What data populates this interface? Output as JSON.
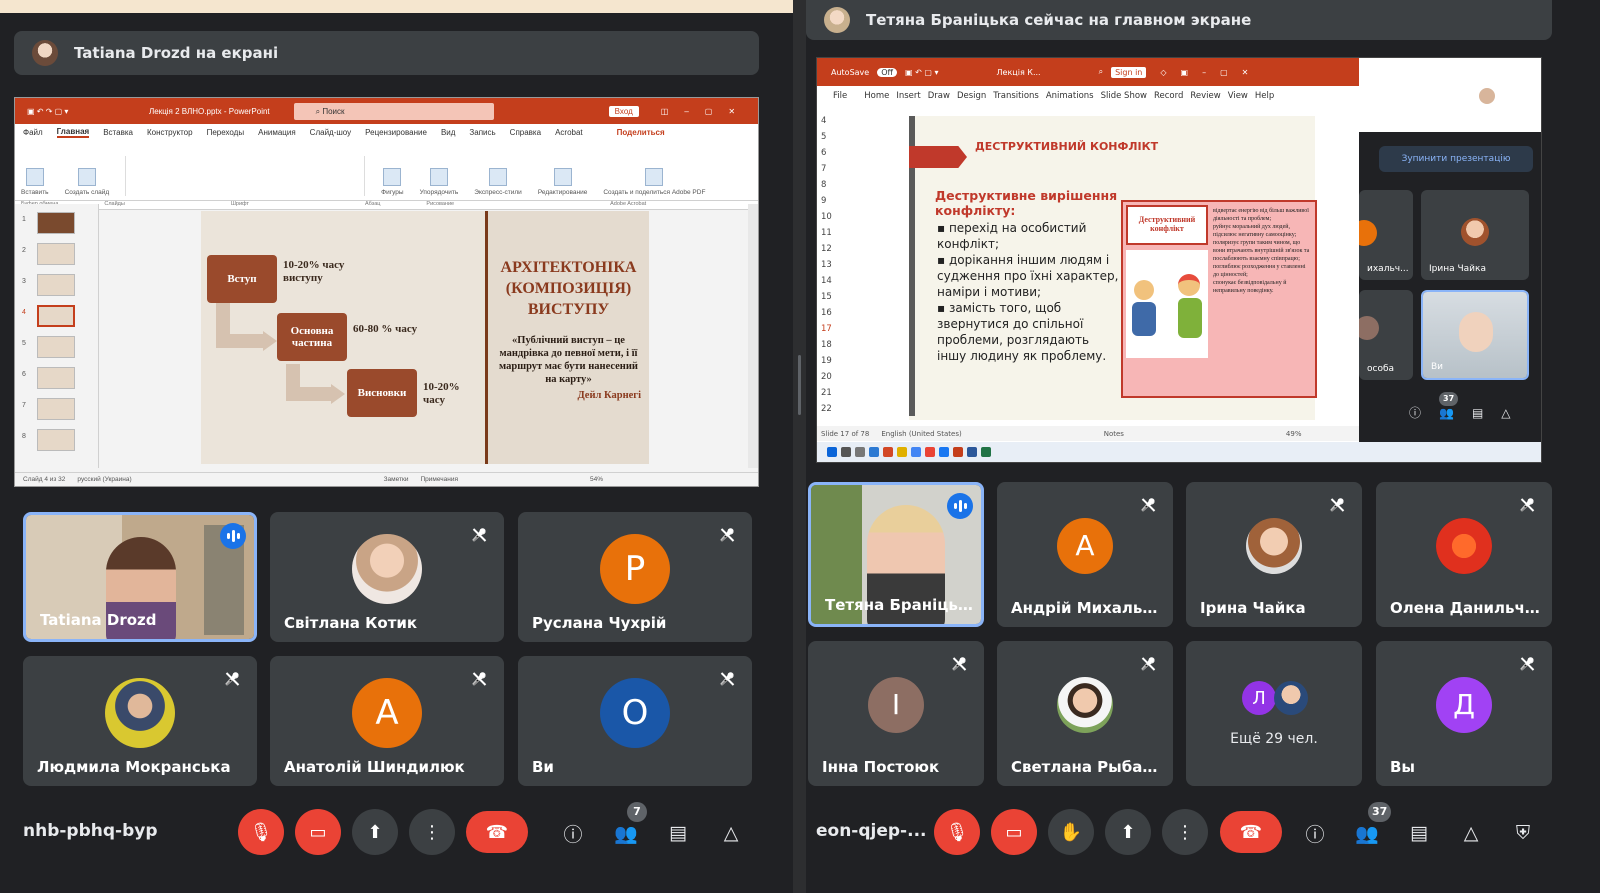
{
  "left": {
    "banner": "Tatiana Drozd на екрані",
    "ppt": {
      "title": "Лекція 2 ВЛНО.pptx  -  PowerPoint",
      "search": "Поиск",
      "signin": "Вход",
      "menu": [
        "Файл",
        "Главная",
        "Вставка",
        "Конструктор",
        "Переходы",
        "Анимация",
        "Слайд-шоу",
        "Рецензирование",
        "Вид",
        "Запись",
        "Справка",
        "Acrobat"
      ],
      "share": "Поделиться",
      "ribbon": [
        "Вставить",
        "Создать слайд",
        "Фигуры",
        "Упорядочить",
        "Экспресс-стили",
        "Редактирование",
        "Создать и поделиться Adobe PDF"
      ],
      "ribbon_groups": [
        "Буфер обмена",
        "Слайды",
        "Шрифт",
        "Абзац",
        "Рисование",
        "Adobe Acrobat"
      ],
      "slide": {
        "box1": "Вступ",
        "box2": "Основна частина",
        "box3": "Висновки",
        "pct1": "10-20% часу виступу",
        "pct2": "60-80 % часу",
        "pct3": "10-20% часу",
        "heading": "АРХІТЕКТОНІКА (КОМПОЗИЦІЯ) ВИСТУПУ",
        "quote": "«Публічний виступ – це мандрівка до певної мети, і її маршрут має бути нанесений на карту»",
        "author": "Дейл Карнегі"
      },
      "thumb_numbers": [
        "1",
        "2",
        "3",
        "4",
        "5",
        "6",
        "7",
        "8"
      ],
      "status_left": "Слайд 4 из 32",
      "status_lang": "русский (Украина)",
      "status_notes": "Заметки",
      "status_comments": "Примечания",
      "zoom": "54%"
    },
    "tiles": [
      {
        "name": "Tatiana Drozd",
        "kind": "video",
        "speaking": true
      },
      {
        "name": "Світлана Котик",
        "kind": "photo",
        "muted": true
      },
      {
        "name": "Руслана Чухрій",
        "kind": "letter",
        "letter": "Р",
        "color": "#e8710a",
        "muted": true
      },
      {
        "name": "Людмила Мокранська",
        "kind": "photo",
        "muted": true
      },
      {
        "name": "Анатолій Шиндилюк",
        "kind": "letter",
        "letter": "А",
        "color": "#e8710a",
        "muted": true
      },
      {
        "name": "Ви",
        "kind": "letter",
        "letter": "О",
        "color": "#1a57a8",
        "muted": true
      }
    ],
    "meeting_code": "nhb-pbhq-byp",
    "participants_count": "7"
  },
  "right": {
    "banner": "Тетяна Браніцька сейчас на главном экране",
    "ppt": {
      "autosave": "AutoSave",
      "autosave_state": "Off",
      "file": "Лекція К...",
      "signin": "Sign in",
      "menu": [
        "File",
        "Home",
        "Insert",
        "Draw",
        "Design",
        "Transitions",
        "Animations",
        "Slide Show",
        "Record",
        "Review",
        "View",
        "Help"
      ],
      "line_numbers": [
        "4",
        "5",
        "6",
        "7",
        "8",
        "9",
        "10",
        "11",
        "12",
        "13",
        "14",
        "15",
        "16",
        "17",
        "18",
        "19",
        "20",
        "21",
        "22"
      ],
      "slide": {
        "title": "ДЕСТРУКТИВНИЙ КОНФЛІКТ",
        "subtitle": "Деструктивне вирішення конфлікту:",
        "bullets": [
          "перехід на особистий конфлікт;",
          "дорікання іншим людям і судження про їхні характер, наміри і мотиви;",
          "замість того, щоб звернутися до спільної проблеми, розглядають іншу людину як проблему."
        ],
        "card_title": "Деструктивний конфлікт",
        "card_points": [
          "відвертає енергію від більш важливої діяльності та проблем;",
          "руйнує моральний дух людей, підсилює негативну самооцінку;",
          "поляризує групи таким чином, що вони втрачають внутрішній зв'язок та послаблюють взаємну співпрацю;",
          "поглиблює розходження у ставленні до цінностей;",
          "спонукає безвідповідальну й неправильну поведінку."
        ]
      },
      "status_slide": "Slide 17 of 78",
      "status_lang": "English (United States)",
      "status_notes": "Notes",
      "zoom": "49%"
    },
    "mini_panel": {
      "stop_label": "Зупинити презентацію",
      "tiles": [
        {
          "name": "ихальч..."
        },
        {
          "name": "Ірина Чайка"
        },
        {
          "name": "особа"
        },
        {
          "name": "Ви"
        }
      ],
      "count": "37"
    },
    "tiles": [
      {
        "name": "Тетяна Браніцька",
        "kind": "video",
        "speaking": true
      },
      {
        "name": "Андрій Михальчук",
        "kind": "letter",
        "letter": "А",
        "color": "#e8710a",
        "muted": true
      },
      {
        "name": "Ірина Чайка",
        "kind": "photo",
        "muted": true
      },
      {
        "name": "Олена Данильче...",
        "kind": "flower",
        "muted": true
      },
      {
        "name": "Інна Постоюк",
        "kind": "letter",
        "letter": "І",
        "color": "#8d6e63",
        "muted": true
      },
      {
        "name": "Светлана Рыбач...",
        "kind": "photo",
        "muted": true
      },
      {
        "name": "",
        "kind": "more",
        "more_label": "Ещё 29 чел.",
        "more_letter": "Л"
      },
      {
        "name": "Вы",
        "kind": "letter",
        "letter": "Д",
        "color": "#a142f4",
        "muted": true
      }
    ],
    "meeting_code": "eon-qjep-...",
    "participants_count": "37"
  },
  "icons": {
    "mic_off": "mic-off-icon",
    "cam_off": "camera-off-icon",
    "present": "present-screen-icon",
    "more": "more-options-icon",
    "end": "end-call-icon",
    "info": "info-icon",
    "people": "people-icon",
    "chat": "chat-icon",
    "activities": "activities-icon",
    "hand": "raise-hand-icon",
    "host": "host-controls-icon"
  },
  "colors": {
    "bg": "#202124",
    "tile": "#3c4043",
    "red": "#ea4335",
    "ppt_red": "#c43e1c",
    "speaking": "#8ab4f8"
  }
}
